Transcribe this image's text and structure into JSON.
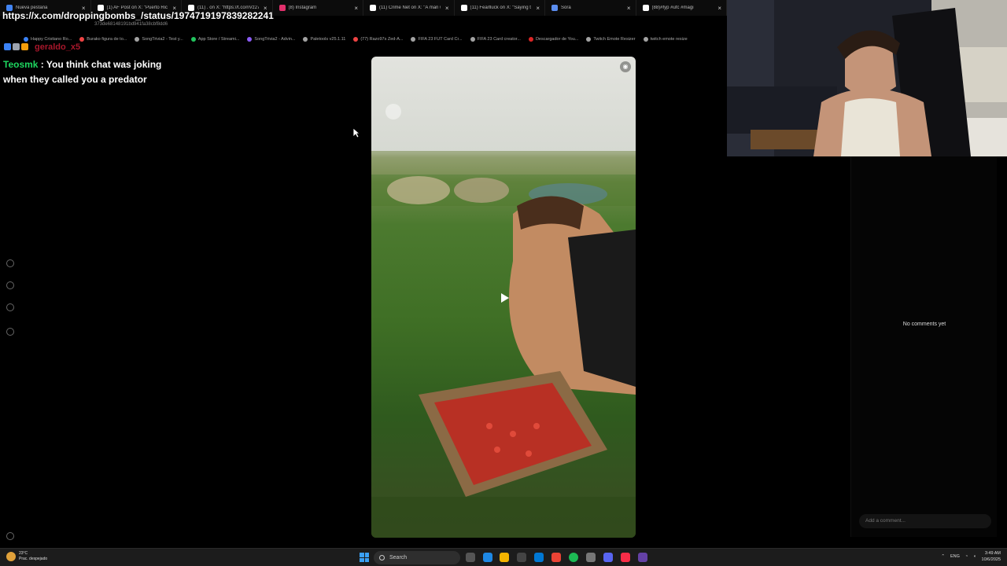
{
  "browser": {
    "tabs": [
      {
        "label": "Nueva pestaña",
        "icon": "chrome-icon",
        "color": "#4285f4"
      },
      {
        "label": "(1) AF Post on X: \"Puerto Rico",
        "icon": "x-icon",
        "color": "#ffffff"
      },
      {
        "label": "(11) . on X: \"https://t.co/nVz27",
        "icon": "x-icon",
        "color": "#ffffff"
      },
      {
        "label": "(8) Instagram",
        "icon": "instagram-icon",
        "color": "#e1306c"
      },
      {
        "label": "(11) Crime Net on X: \"A man w",
        "icon": "x-icon",
        "color": "#ffffff"
      },
      {
        "label": "(11) Fearlluck on X: \"Saying th",
        "icon": "x-icon",
        "color": "#ffffff"
      },
      {
        "label": "Sora",
        "icon": "sora-icon",
        "color": "#5b8def"
      },
      {
        "label": "(88)#fyp #ufc #magi",
        "icon": "tiktok-icon",
        "color": "#ffffff"
      }
    ],
    "address_hint": "373de68148191bd941fa38cbf8dd6",
    "bookmarks": [
      {
        "label": "Happy Cristiano Ro...",
        "color": "#3b82f6"
      },
      {
        "label": "Burako figura de to...",
        "color": "#ef4444"
      },
      {
        "label": "SongTrivia2 - Test y...",
        "color": "#a3a3a3"
      },
      {
        "label": "App Store / Streami...",
        "color": "#22c55e"
      },
      {
        "label": "SongTrivia2 - Advin...",
        "color": "#8b5cf6"
      },
      {
        "label": "Paletools v25.1.11",
        "color": "#a3a3a3"
      },
      {
        "label": "(77) Razo97s Zed-A...",
        "color": "#ef4444"
      },
      {
        "label": "FIFA 23 FUT Card Cr...",
        "color": "#a3a3a3"
      },
      {
        "label": "FIFA 23 Card creator...",
        "color": "#a3a3a3"
      },
      {
        "label": "Descargador de You...",
        "color": "#dc2626"
      },
      {
        "label": "Twitch Emote Resizer",
        "color": "#a3a3a3"
      },
      {
        "label": "twitch emote resize",
        "color": "#a3a3a3"
      }
    ]
  },
  "overlay": {
    "link_text": "https://x.com/droppingbombs_/status/1974719197839282241",
    "chat_user2": "geraldo_x5",
    "message": {
      "user": "Teosmk",
      "text": " : You think chat was joking when they called you a predator"
    }
  },
  "comments": {
    "empty_text": "No comments yet",
    "input_placeholder": "Add a comment..."
  },
  "taskbar": {
    "weather_temp": "23°C",
    "weather_desc": "Prac. despejado",
    "search_label": "Search",
    "language": "ENG",
    "time": "3:49 AM",
    "date": "10/6/2025"
  }
}
